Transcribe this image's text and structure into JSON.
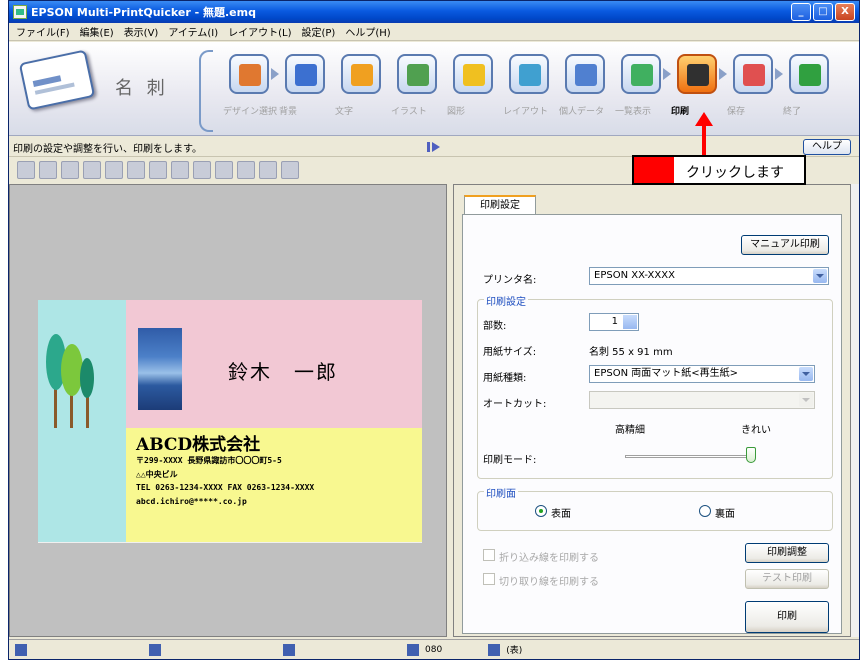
{
  "window": {
    "title": "EPSON Multi-PrintQuicker - 無題.emq",
    "buttons": [
      "_",
      "□",
      "X"
    ]
  },
  "menu": [
    "ファイル(F)",
    "編集(E)",
    "表示(V)",
    "アイテム(I)",
    "レイアウト(L)",
    "設定(P)",
    "ヘルプ(H)"
  ],
  "mode_label": "名 刺",
  "steps": [
    {
      "label": "デザイン選択",
      "icon": "design-icon",
      "color": "#e07830"
    },
    {
      "label": "背景",
      "icon": "background-icon",
      "color": "#3c70d0"
    },
    {
      "label": "文字",
      "icon": "text-icon",
      "color": "#f0a020"
    },
    {
      "label": "イラスト",
      "icon": "illustration-icon",
      "color": "#50a050"
    },
    {
      "label": "図形",
      "icon": "shape-icon",
      "color": "#f0c020"
    },
    {
      "label": "レイアウト",
      "icon": "layout-icon",
      "color": "#40a0d0"
    },
    {
      "label": "個人データ",
      "icon": "personal-data-icon",
      "color": "#5080d0"
    },
    {
      "label": "一覧表示",
      "icon": "list-view-icon",
      "color": "#40b060"
    },
    {
      "label": "印刷",
      "icon": "printer-icon",
      "color": "#303030"
    },
    {
      "label": "保存",
      "icon": "save-icon",
      "color": "#e05050"
    },
    {
      "label": "終了",
      "icon": "exit-icon",
      "color": "#30a040"
    }
  ],
  "hint": {
    "text": "印刷の設定や調整を行い、印刷をします。",
    "help_button": "ヘルプ"
  },
  "callout": {
    "text": "クリックします"
  },
  "card": {
    "name": "鈴木　一郎",
    "company": "ABCD株式会社",
    "address": "〒299-XXXX 長野県諏訪市〇〇〇町5-5",
    "building": "△△中央ビル",
    "phone": "TEL 0263-1234-XXXX FAX 0263-1234-XXXX",
    "email": "abcd.ichiro@*****.co.jp"
  },
  "print_panel": {
    "tab": "印刷設定",
    "manual_print": "マニュアル印刷",
    "printer_label": "プリンタ名:",
    "printer_value": "EPSON XX-XXXX",
    "settings_group": "印刷設定",
    "copies_label": "部数:",
    "copies_value": "1",
    "paper_size_label": "用紙サイズ:",
    "paper_size_value": "名刺 55 x 91 mm",
    "paper_type_label": "用紙種類:",
    "paper_type_value": "EPSON 両面マット紙<再生紙>",
    "autocut_label": "オートカット:",
    "autocut_value": "",
    "quality_left": "高精細",
    "quality_right": "きれい",
    "mode_label": "印刷モード:",
    "mode_level_percent": 100,
    "side_group": "印刷面",
    "side_front": "表面",
    "side_back": "裏面",
    "fold_line": "折り込み線を印刷する",
    "cut_line": "切り取り線を印刷する",
    "adjust_button": "印刷調整",
    "test_button": "テスト印刷",
    "print_button": "印刷"
  },
  "status": {
    "zoom": "080",
    "page": "(表)"
  }
}
